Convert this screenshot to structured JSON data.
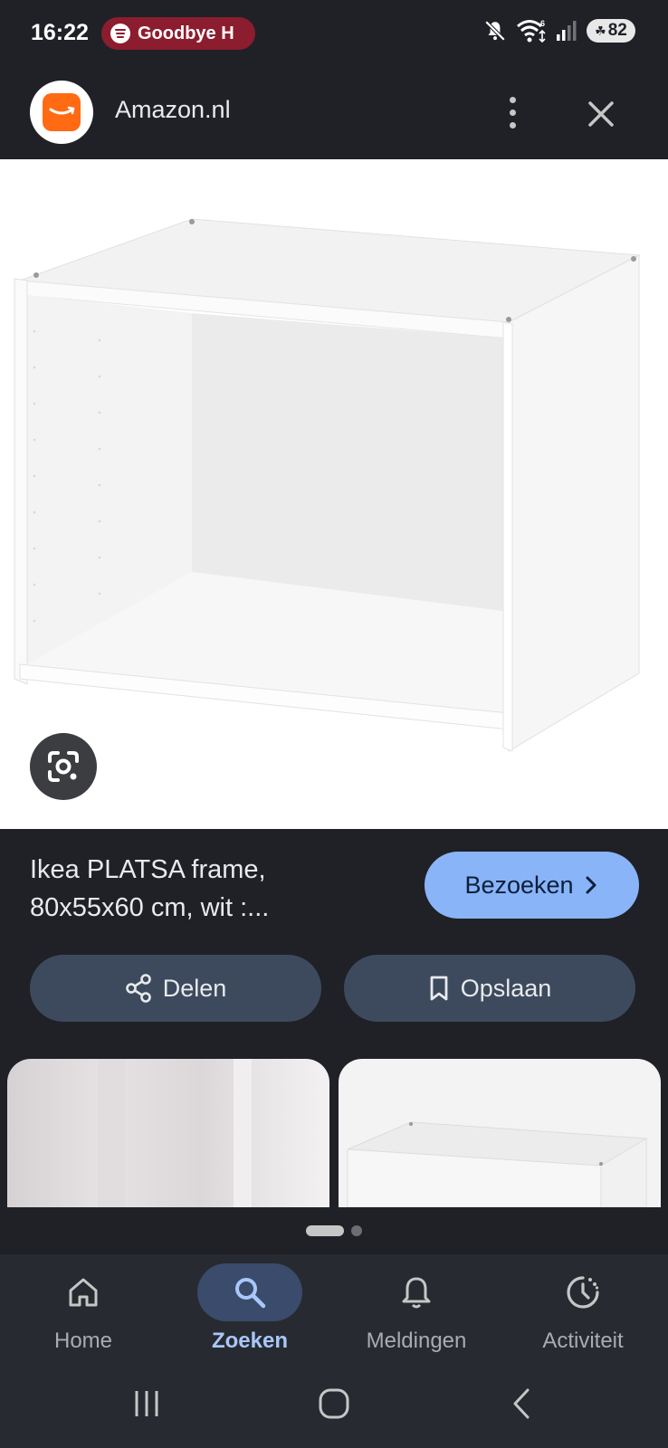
{
  "status_bar": {
    "time": "16:22",
    "media_text": "Goodbye H",
    "battery": "82",
    "icons": [
      "spotify-icon",
      "mute-icon",
      "wifi-icon",
      "signal-icon",
      "battery-icon"
    ]
  },
  "header": {
    "site_name": "Amazon.nl",
    "logo_color": "#ff6a13"
  },
  "result": {
    "title_line1": "Ikea PLATSA frame,",
    "title_line2": "80x55x60 cm, wit :...",
    "visit_label": "Bezoeken",
    "share_label": "Delen",
    "save_label": "Opslaan"
  },
  "pager": {
    "pages": 2,
    "active": 1
  },
  "nav": {
    "items": [
      {
        "label": "Home",
        "icon": "home-icon"
      },
      {
        "label": "Zoeken",
        "icon": "search-icon"
      },
      {
        "label": "Meldingen",
        "icon": "bell-icon"
      },
      {
        "label": "Activiteit",
        "icon": "activity-icon"
      }
    ],
    "active": "Zoeken"
  },
  "colors": {
    "background": "#1f2127",
    "accent": "#8ab4f8",
    "pill": "#3d4a5e",
    "nav_active": "#a8c7fa"
  }
}
